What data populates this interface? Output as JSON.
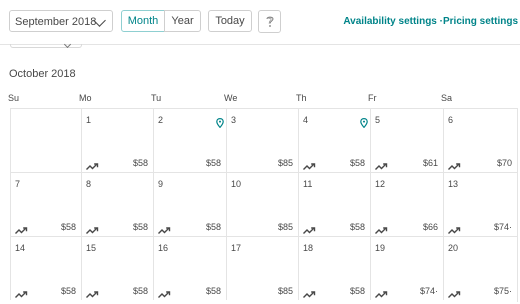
{
  "toolbar": {
    "month_select": "September 2018",
    "view_month": "Month",
    "view_year": "Year",
    "today": "Today",
    "help_icon": "question-icon",
    "availability_link": "Availability settings",
    "separator": "·",
    "pricing_link": "Pricing settings"
  },
  "calendar": {
    "month_title": "October 2018",
    "weekdays": [
      "Su",
      "Mo",
      "Tu",
      "We",
      "Th",
      "Fr",
      "Sa"
    ],
    "weeks": [
      [
        {
          "day": "",
          "price": "",
          "trend": false,
          "pin": false
        },
        {
          "day": "1",
          "price": "$58",
          "trend": true,
          "pin": false
        },
        {
          "day": "2",
          "price": "$58",
          "trend": false,
          "pin": true
        },
        {
          "day": "3",
          "price": "$85",
          "trend": false,
          "pin": false
        },
        {
          "day": "4",
          "price": "$58",
          "trend": true,
          "pin": true
        },
        {
          "day": "5",
          "price": "$61",
          "trend": true,
          "pin": false
        },
        {
          "day": "6",
          "price": "$70",
          "trend": true,
          "pin": false
        }
      ],
      [
        {
          "day": "7",
          "price": "$58",
          "trend": true,
          "pin": false
        },
        {
          "day": "8",
          "price": "$58",
          "trend": true,
          "pin": false
        },
        {
          "day": "9",
          "price": "$58",
          "trend": true,
          "pin": false
        },
        {
          "day": "10",
          "price": "$85",
          "trend": false,
          "pin": false
        },
        {
          "day": "11",
          "price": "$58",
          "trend": true,
          "pin": false
        },
        {
          "day": "12",
          "price": "$66",
          "trend": true,
          "pin": false
        },
        {
          "day": "13",
          "price": "$74·",
          "trend": true,
          "pin": false
        }
      ],
      [
        {
          "day": "14",
          "price": "$58",
          "trend": true,
          "pin": false
        },
        {
          "day": "15",
          "price": "$58",
          "trend": true,
          "pin": false
        },
        {
          "day": "16",
          "price": "$58",
          "trend": true,
          "pin": false
        },
        {
          "day": "17",
          "price": "$85",
          "trend": false,
          "pin": false
        },
        {
          "day": "18",
          "price": "$58",
          "trend": true,
          "pin": false
        },
        {
          "day": "19",
          "price": "$74·",
          "trend": true,
          "pin": false
        },
        {
          "day": "20",
          "price": "$75·",
          "trend": true,
          "pin": false
        }
      ]
    ]
  },
  "colors": {
    "accent": "#008489",
    "grid": "#e4e4e4",
    "text": "#484848"
  },
  "icons": {
    "trend": "trend-up-icon",
    "pin": "location-pin-icon",
    "chevron": "chevron-down-icon"
  }
}
